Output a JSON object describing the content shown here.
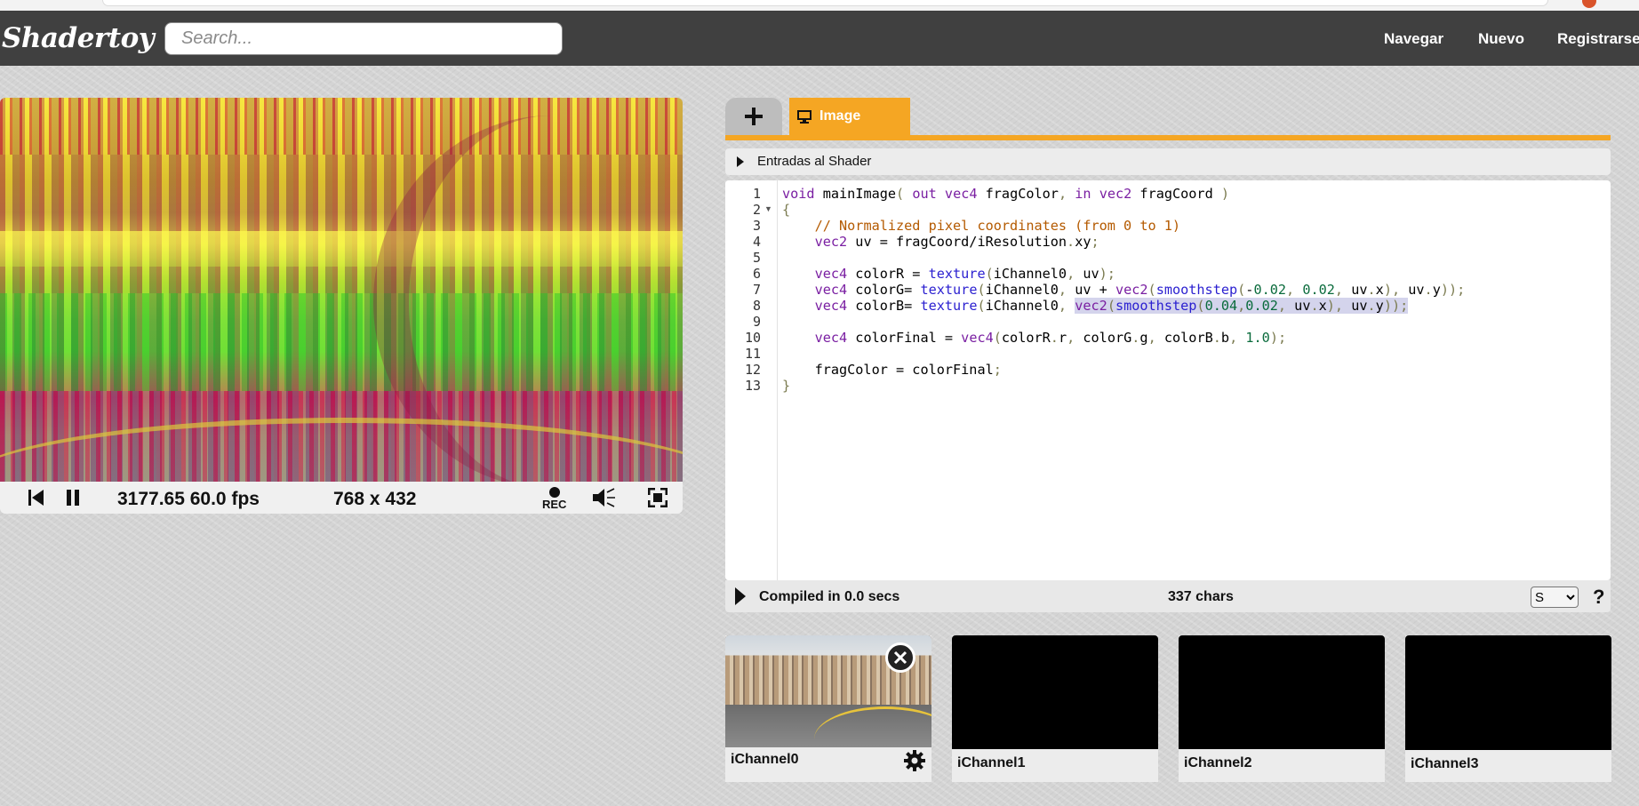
{
  "header": {
    "logo": "Shadertoy",
    "search_placeholder": "Search...",
    "nav": [
      "Navegar",
      "Nuevo",
      "Registrarse"
    ]
  },
  "player": {
    "time_fps": "3177.65 60.0 fps",
    "resolution": "768 x 432",
    "rec_label": "REC",
    "icons": [
      "rewind-icon",
      "pause-icon",
      "record-icon",
      "volume-icon",
      "fullscreen-icon"
    ]
  },
  "editor": {
    "tab_image_label": "Image",
    "inputs_label": "Entradas al Shader",
    "line_numbers": [
      "1",
      "2",
      "3",
      "4",
      "5",
      "6",
      "7",
      "8",
      "9",
      "10",
      "11",
      "12",
      "13"
    ],
    "compile_status": "Compiled in 0.0 secs",
    "char_count": "337 chars",
    "size_select": "S",
    "help_label": "?"
  },
  "channels": [
    {
      "label": "iChannel0",
      "has_texture": true
    },
    {
      "label": "iChannel1",
      "has_texture": false
    },
    {
      "label": "iChannel2",
      "has_texture": false
    },
    {
      "label": "iChannel3",
      "has_texture": false
    }
  ],
  "colors": {
    "header_bg": "#404040",
    "accent": "#f5a623",
    "editor_bg": "#ffffff"
  }
}
